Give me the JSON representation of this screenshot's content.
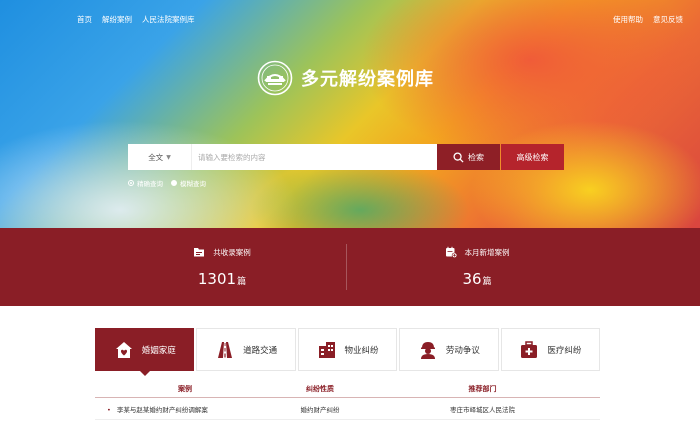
{
  "nav": {
    "left": [
      "首页",
      "解纷案例",
      "人民法院案例库"
    ],
    "right": [
      "使用帮助",
      "意见反馈"
    ]
  },
  "site": {
    "title": "多元解纷案例库"
  },
  "search": {
    "scope": "全文",
    "placeholder": "请输入要检索的内容",
    "search_label": "检索",
    "advanced_label": "高级检索",
    "modes": [
      {
        "label": "精确查询",
        "selected": false
      },
      {
        "label": "模糊查询",
        "selected": true
      }
    ]
  },
  "stats": [
    {
      "label": "共收录案例",
      "value": "1301",
      "unit": "篇",
      "icon": "folder-icon"
    },
    {
      "label": "本月新增案例",
      "value": "36",
      "unit": "篇",
      "icon": "calendar-add-icon"
    }
  ],
  "categories": [
    {
      "label": "婚姻家庭",
      "icon": "home-heart-icon",
      "active": true
    },
    {
      "label": "道路交通",
      "icon": "road-icon",
      "active": false
    },
    {
      "label": "物业纠纷",
      "icon": "building-icon",
      "active": false
    },
    {
      "label": "劳动争议",
      "icon": "worker-icon",
      "active": false
    },
    {
      "label": "医疗纠纷",
      "icon": "medical-kit-icon",
      "active": false
    }
  ],
  "table": {
    "headers": [
      "案例",
      "纠纷性质",
      "推荐部门"
    ],
    "rows": [
      [
        "李某与赵某婚约财产纠纷调解案",
        "婚约财产纠纷",
        "枣庄市峄城区人民法院"
      ]
    ]
  },
  "colors": {
    "primary": "#8a1e26",
    "accent": "#b5242c"
  }
}
